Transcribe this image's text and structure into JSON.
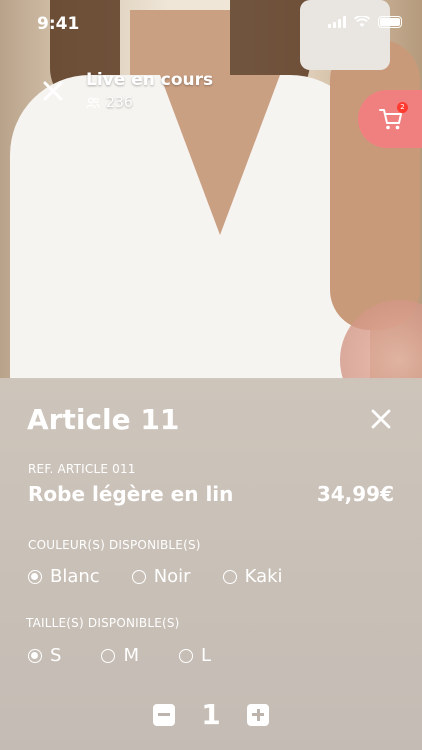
{
  "status_bar": {
    "time": "9:41"
  },
  "live": {
    "title": "Live en cours",
    "viewers": "236"
  },
  "cart": {
    "badge_count": "2"
  },
  "article": {
    "title": "Article 11",
    "ref": "REF. ARTICLE 011",
    "name": "Robe légère en lin",
    "price": "34,99€"
  },
  "colors": {
    "label": "COULEUR(S) DISPONIBLE(S)",
    "options": [
      {
        "label": "Blanc",
        "selected": true
      },
      {
        "label": "Noir",
        "selected": false
      },
      {
        "label": "Kaki",
        "selected": false
      }
    ]
  },
  "sizes": {
    "label": "TAILLE(S) DISPONIBLE(S)",
    "options": [
      {
        "label": "S",
        "selected": true
      },
      {
        "label": "M",
        "selected": false
      },
      {
        "label": "L",
        "selected": false
      }
    ]
  },
  "quantity": {
    "value": "1"
  },
  "theme": {
    "accent": "#f08080",
    "badge": "#ff3b30",
    "text": "#ffffff"
  }
}
